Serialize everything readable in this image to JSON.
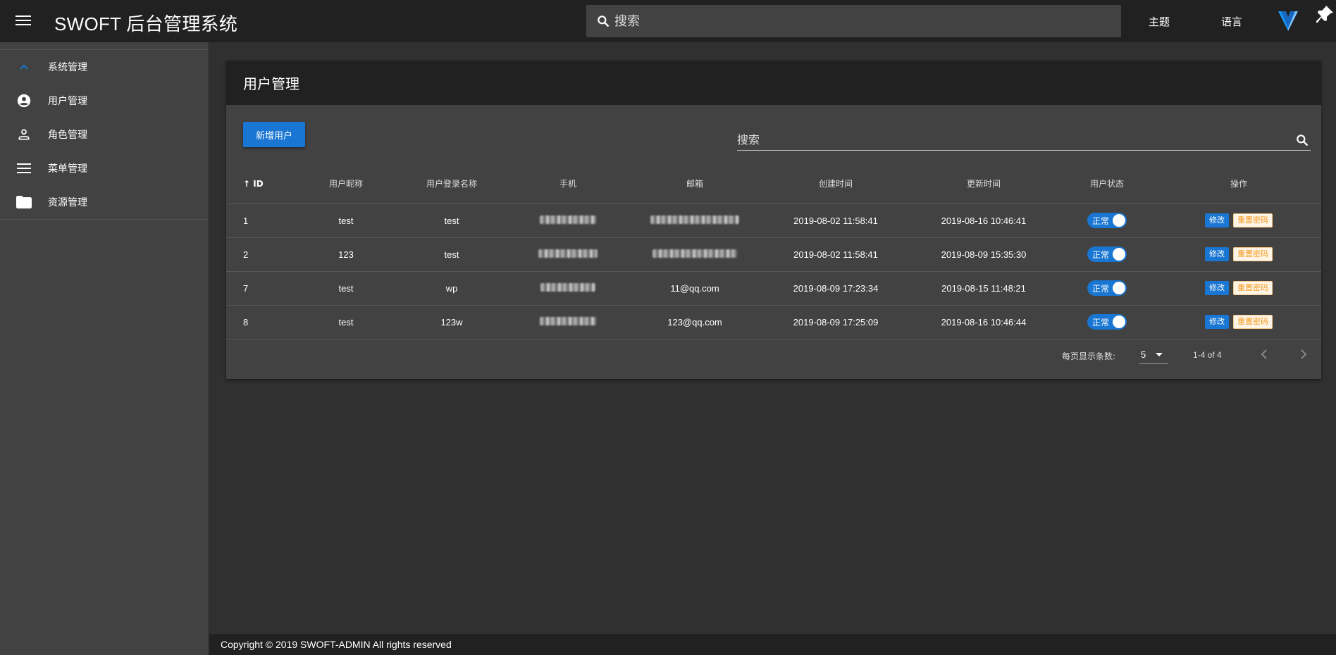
{
  "header": {
    "title": "SWOFT 后台管理系统",
    "search_placeholder": "搜索",
    "theme_label": "主题",
    "language_label": "语言"
  },
  "sidebar": {
    "items": [
      {
        "label": "系统管理",
        "icon": "chevron-up-icon"
      },
      {
        "label": "用户管理",
        "icon": "account-circle-icon"
      },
      {
        "label": "角色管理",
        "icon": "person-icon"
      },
      {
        "label": "菜单管理",
        "icon": "menu-icon"
      },
      {
        "label": "资源管理",
        "icon": "folder-icon"
      }
    ]
  },
  "main": {
    "title": "用户管理",
    "add_button": "新增用户",
    "search_placeholder": "搜索",
    "columns": [
      "ID",
      "用户昵称",
      "用户登录名称",
      "手机",
      "邮箱",
      "创建时间",
      "更新时间",
      "用户状态",
      "操作"
    ],
    "rows": [
      {
        "id": "1",
        "nickname": "test",
        "login": "test",
        "phone": "",
        "email": "",
        "created": "2019-08-02 11:58:41",
        "updated": "2019-08-16 10:46:41",
        "status": "正常"
      },
      {
        "id": "2",
        "nickname": "123",
        "login": "test",
        "phone": "",
        "email": "",
        "created": "2019-08-02 11:58:41",
        "updated": "2019-08-09 15:35:30",
        "status": "正常"
      },
      {
        "id": "7",
        "nickname": "test",
        "login": "wp",
        "phone": "",
        "email": "11@qq.com",
        "created": "2019-08-09 17:23:34",
        "updated": "2019-08-15 11:48:21",
        "status": "正常"
      },
      {
        "id": "8",
        "nickname": "test",
        "login": "123w",
        "phone": "",
        "email": "123@qq.com",
        "created": "2019-08-09 17:25:09",
        "updated": "2019-08-16 10:46:44",
        "status": "正常"
      }
    ],
    "edit_label": "修改",
    "reset_label": "重置密码",
    "pagination": {
      "rows_per_page_label": "每页显示条数:",
      "rows_per_page": "5",
      "range": "1-4 of 4"
    }
  },
  "footer": {
    "copyright": "Copyright © 2019 SWOFT-ADMIN All rights reserved"
  },
  "colors": {
    "accent": "#1976d2",
    "reset_text": "#f59a23",
    "background": "#303030",
    "surface": "#424242",
    "appbar": "#212121"
  }
}
